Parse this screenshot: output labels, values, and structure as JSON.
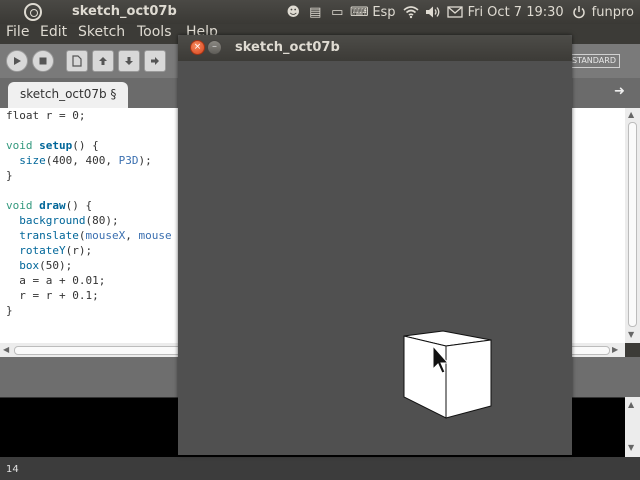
{
  "top_panel": {
    "app_title": "sketch_oct07b",
    "keyboard_layout": "Esp",
    "datetime": "Fri Oct  7 19:30",
    "user": "funpro"
  },
  "menu": {
    "items": [
      "File",
      "Edit",
      "Sketch",
      "Tools",
      "Help"
    ]
  },
  "toolbar": {
    "mode": "STANDARD"
  },
  "tab": {
    "label": "sketch_oct07b §"
  },
  "code": {
    "line1": "float r = 0;",
    "line2_kw": "void",
    "line2_fn": "setup",
    "line2_rest": "() {",
    "line3_fn": "size",
    "line3_a": "(400, 400, ",
    "line3_b": "P3D",
    "line3_c": ");",
    "line4": "}",
    "line5_kw": "void",
    "line5_fn": "draw",
    "line5_rest": "() {",
    "line6_fn": "background",
    "line6_rest": "(80);",
    "line7_fn": "translate",
    "line7_a": "(",
    "line7_b": "mouseX",
    "line7_c": ", ",
    "line7_d": "mouse",
    "line8_fn": "rotateY",
    "line8_rest": "(r);",
    "line9_fn": "box",
    "line9_rest": "(50);",
    "line10": "a = a + 0.01;",
    "line11": "r = r + 0.1;",
    "line12": "}"
  },
  "status": {
    "line_number": "14"
  },
  "sketch_window": {
    "title": "sketch_oct07b"
  },
  "colors": {
    "canvas_background": "#505050",
    "keyword": "#33997e",
    "function": "#006699"
  }
}
